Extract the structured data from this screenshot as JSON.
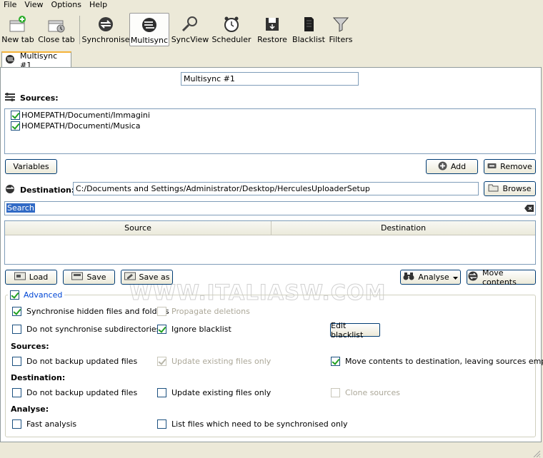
{
  "menu": [
    "File",
    "View",
    "Options",
    "Help"
  ],
  "toolbar": [
    {
      "label": "New tab",
      "icon": "new-tab-icon"
    },
    {
      "label": "Close tab",
      "icon": "close-tab-icon"
    },
    {
      "label": "Synchronise",
      "icon": "synchronise-icon"
    },
    {
      "label": "Multisync",
      "icon": "multisync-icon"
    },
    {
      "label": "SyncView",
      "icon": "syncview-icon"
    },
    {
      "label": "Scheduler",
      "icon": "scheduler-icon"
    },
    {
      "label": "Restore",
      "icon": "restore-icon"
    },
    {
      "label": "Blacklist",
      "icon": "blacklist-icon"
    },
    {
      "label": "Filters",
      "icon": "filters-icon"
    }
  ],
  "tab": {
    "label": "Multisync #1"
  },
  "main": {
    "name_value": "Multisync #1",
    "sources_label": "Sources:",
    "sources": [
      {
        "path": "HOMEPATH/Documenti/Immagini",
        "checked": true
      },
      {
        "path": "HOMEPATH/Documenti/Musica",
        "checked": true
      }
    ],
    "variables_button": "Variables",
    "add_button": "Add",
    "remove_button": "Remove",
    "destination_label": "Destination:",
    "destination_value": "C:/Documents and Settings/Administrator/Desktop/HerculesUploaderSetup",
    "browse_button": "Browse",
    "search_value": "Search",
    "table_headers": [
      "Source",
      "Destination"
    ],
    "load_button": "Load",
    "save_button": "Save",
    "save_as_button": "Save as",
    "analyse_button": "Analyse",
    "move_contents_button": "Move contents",
    "watermark": "WWW.ITALIASW.COM"
  },
  "advanced": {
    "label": "Advanced",
    "sync_hidden": "Synchronise hidden files and folders",
    "propagate_deletions": "Propagate deletions",
    "no_subdirs": "Do not synchronise subdirectories",
    "ignore_blacklist": "Ignore blacklist",
    "edit_blacklist_button": "Edit blacklist",
    "sources_heading": "Sources:",
    "src_no_backup": "Do not backup updated files",
    "src_update_existing": "Update existing files only",
    "src_move_contents": "Move contents to destination, leaving sources empty",
    "destination_heading": "Destination:",
    "dst_no_backup": "Do not backup updated files",
    "dst_update_existing": "Update existing files only",
    "clone_sources": "Clone sources",
    "analyse_heading": "Analyse:",
    "fast_analysis": "Fast analysis",
    "list_files": "List files which need to be synchronised only"
  }
}
